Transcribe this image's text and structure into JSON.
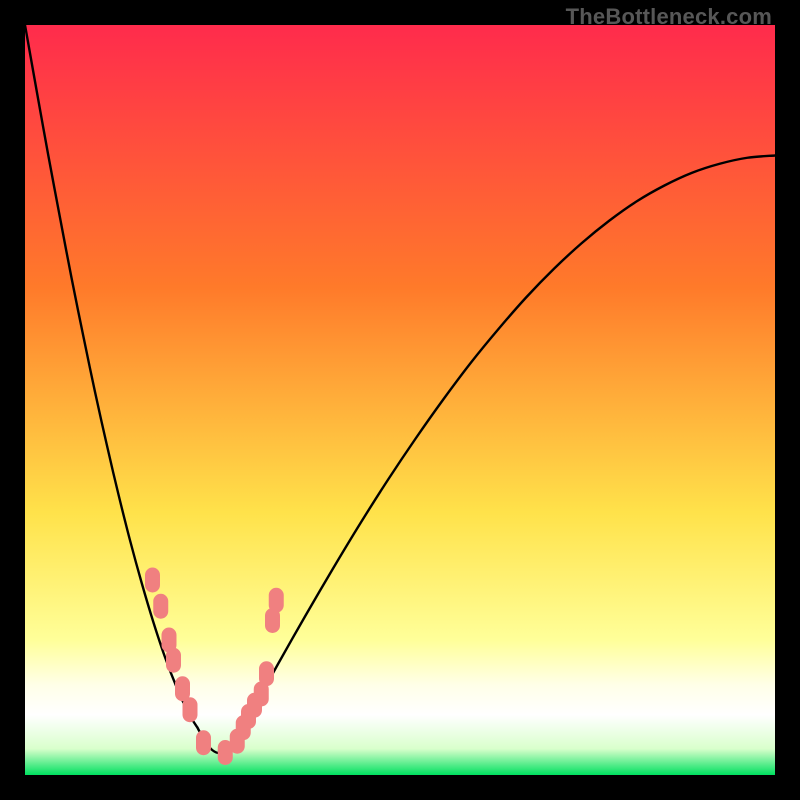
{
  "watermark": "TheBottleneck.com",
  "colors": {
    "bg": "#000000",
    "watermark": "#575757",
    "curve": "#000000",
    "marker_fill": "#f08080",
    "marker_stroke": "#f08080",
    "grad_top": "#ff2b4c",
    "grad_mid": "#ffc400",
    "grad_low": "#ffff99",
    "grad_white1": "#ffffe8",
    "grad_white2": "#ffffff",
    "grad_bottom": "#00e060"
  },
  "chart_data": {
    "type": "line",
    "title": "",
    "xlabel": "",
    "ylabel": "",
    "x_range": [
      0,
      100
    ],
    "y_range": [
      0,
      100
    ],
    "axes_visible": false,
    "grid": false,
    "curve_left": {
      "x": [
        0.0,
        1.56,
        3.11,
        4.67,
        6.22,
        7.78,
        9.33,
        10.89,
        12.44,
        14.0,
        15.56,
        17.11,
        18.67,
        20.22,
        21.78,
        23.0
      ],
      "y": [
        100.0,
        91.2,
        82.6,
        74.3,
        66.2,
        58.5,
        51.1,
        44.1,
        37.5,
        31.3,
        25.6,
        20.4,
        15.7,
        11.7,
        8.3,
        6.3
      ]
    },
    "curve_valley": {
      "x": [
        23.0,
        24.0,
        25.0,
        26.0,
        27.0,
        28.0,
        29.0,
        30.0
      ],
      "y": [
        6.3,
        4.5,
        3.3,
        2.9,
        3.2,
        4.3,
        6.0,
        8.0
      ]
    },
    "curve_right": {
      "x": [
        30.0,
        33.68,
        37.37,
        41.05,
        44.74,
        48.42,
        52.11,
        55.79,
        59.47,
        63.16,
        66.84,
        70.53,
        74.21,
        77.89,
        81.58,
        85.26,
        88.95,
        92.63,
        96.32,
        100.0
      ],
      "y": [
        8.0,
        14.7,
        21.2,
        27.5,
        33.6,
        39.4,
        44.9,
        50.1,
        55.0,
        59.5,
        63.7,
        67.5,
        70.9,
        73.9,
        76.5,
        78.6,
        80.3,
        81.5,
        82.3,
        82.6
      ]
    },
    "markers_left": {
      "x": [
        17.0,
        18.1,
        19.2,
        19.8,
        21.0,
        22.0,
        23.8,
        26.7
      ],
      "y": [
        26.0,
        22.5,
        18.0,
        15.3,
        11.5,
        8.7,
        4.3,
        3.0
      ]
    },
    "markers_right": {
      "x": [
        28.3,
        29.1,
        29.8,
        30.6,
        31.5,
        32.2,
        33.0,
        33.5
      ],
      "y": [
        4.5,
        6.3,
        7.8,
        9.3,
        10.8,
        13.5,
        20.6,
        23.3
      ]
    },
    "gradient_stops": [
      {
        "offset": 0.0,
        "color": "#ff2b4c"
      },
      {
        "offset": 0.35,
        "color": "#ff7a2a"
      },
      {
        "offset": 0.65,
        "color": "#ffe24a"
      },
      {
        "offset": 0.82,
        "color": "#ffff99"
      },
      {
        "offset": 0.88,
        "color": "#ffffe8"
      },
      {
        "offset": 0.92,
        "color": "#ffffff"
      },
      {
        "offset": 0.965,
        "color": "#d9ffcc"
      },
      {
        "offset": 1.0,
        "color": "#00e060"
      }
    ]
  }
}
